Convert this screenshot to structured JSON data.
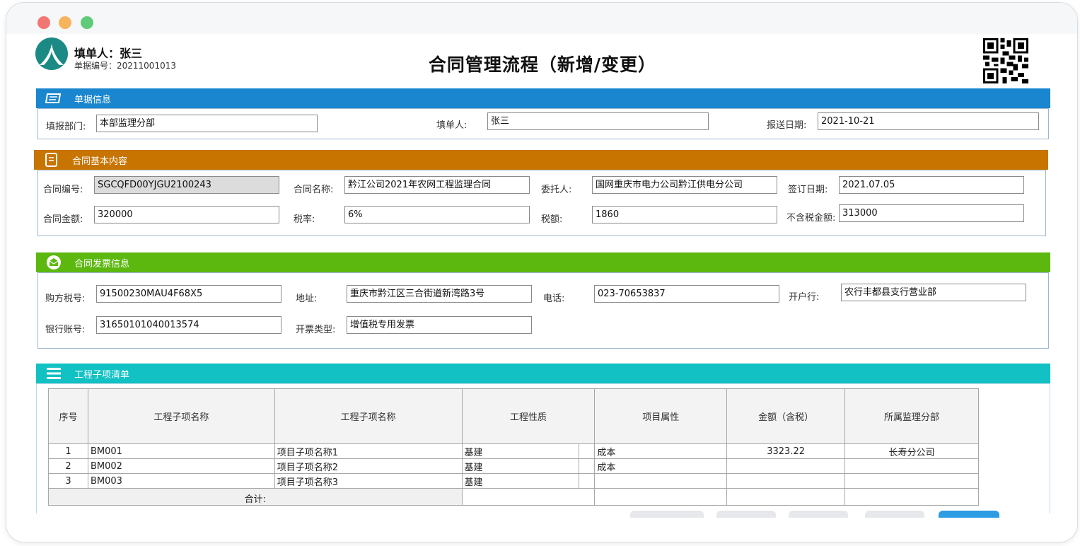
{
  "header": {
    "filler_label": "填单人：张三",
    "doc_no_label": "单据编号：20211001013",
    "title": "合同管理流程（新增/变更）"
  },
  "sections": {
    "bill": {
      "title": "单据信息",
      "color": "#1a86cf",
      "dept_label": "填报部门:",
      "dept_value": "本部监理分部",
      "filler_label": "填单人:",
      "filler_value": "张三",
      "date_label": "报送日期:",
      "date_value": "2021-10-21"
    },
    "contract": {
      "title": "合同基本内容",
      "color": "#c77400",
      "no_label": "合同编号:",
      "no_value": "SGCQFD00YJGU2100243",
      "name_label": "合同名称:",
      "name_value": "黔江公司2021年农网工程监理合同",
      "client_label": "委托人:",
      "client_value": "国网重庆市电力公司黔江供电分公司",
      "sign_label": "签订日期:",
      "sign_value": "2021.07.05",
      "amount_label": "合同金额:",
      "amount_value": "320000",
      "rate_label": "税率:",
      "rate_value": "6%",
      "tax_label": "税额:",
      "tax_value": "1860",
      "notax_label": "不含税金额:",
      "notax_value": "313000"
    },
    "invoice": {
      "title": "合同发票信息",
      "color": "#5cb80f",
      "taxno_label": "购方税号:",
      "taxno_value": "91500230MAU4F68X5",
      "addr_label": "地址:",
      "addr_value": "重庆市黔江区三合街道新湾路3号",
      "phone_label": "电话:",
      "phone_value": "023-70653837",
      "bank_label": "开户行:",
      "bank_value": "农行丰都县支行营业部",
      "account_label": "银行账号:",
      "account_value": "31650101040013574",
      "type_label": "开票类型:",
      "type_value": "增值税专用发票"
    },
    "items": {
      "title": "工程子项清单",
      "color": "#12c1c3",
      "columns": [
        "序号",
        "工程子项名称",
        "工程子项名称",
        "工程性质",
        "项目属性",
        "金额（含税）",
        "所属监理分部"
      ],
      "rows": [
        {
          "no": "1",
          "code": "BM001",
          "name": "项目子项名称1",
          "nature": "基建",
          "attr": "成本",
          "amount": "3323.22",
          "dept": "长寿分公司"
        },
        {
          "no": "2",
          "code": "BM002",
          "name": "项目子项名称2",
          "nature": "基建",
          "attr": "成本",
          "amount": "",
          "dept": ""
        },
        {
          "no": "3",
          "code": "BM003",
          "name": "项目子项名称3",
          "nature": "基建",
          "attr": "",
          "amount": "",
          "dept": ""
        }
      ],
      "total_label": "合计:"
    }
  },
  "icons": {
    "logo": "company-logo",
    "qr": "qr-code-icon",
    "bill": "document-icon",
    "contract": "book-icon",
    "invoice": "envelope-icon",
    "items": "list-icon"
  }
}
